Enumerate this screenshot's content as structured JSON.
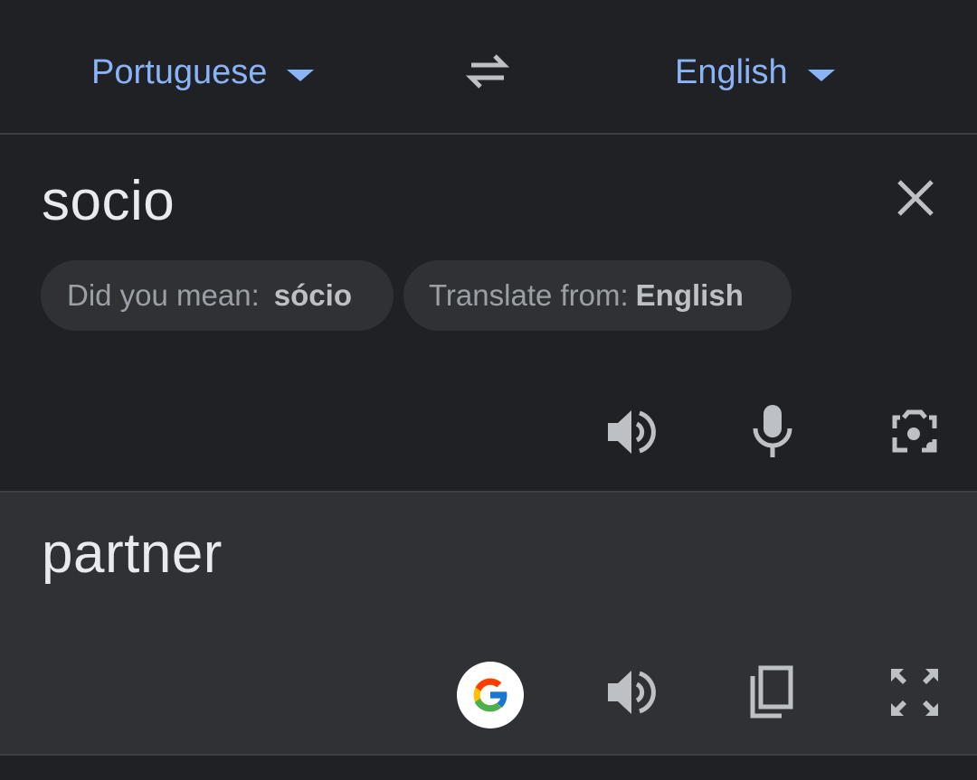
{
  "lang_bar": {
    "source_language": "Portuguese",
    "target_language": "English",
    "source_caret_icon": "caret-down-icon",
    "swap_icon": "swap-arrows-icon",
    "target_caret_icon": "caret-down-icon"
  },
  "input": {
    "text": "socio",
    "clear_icon": "close-icon",
    "suggestions": {
      "did_you_mean_label": "Did you mean:",
      "did_you_mean_value": "sócio",
      "translate_from_label": "Translate from:",
      "translate_from_value": "English"
    },
    "actions": {
      "listen_icon": "speaker-icon",
      "mic_icon": "microphone-icon",
      "camera_icon": "camera-lens-icon"
    }
  },
  "output": {
    "text": "partner",
    "actions": {
      "google_icon": "google-g-icon",
      "listen_icon": "speaker-icon",
      "copy_icon": "copy-icon",
      "fullscreen_icon": "fullscreen-icon"
    }
  },
  "colors": {
    "accent": "#8ab4f8",
    "background": "#202124",
    "output_background": "#303134",
    "chip_background": "#303134",
    "text_primary": "#e8eaed",
    "text_secondary": "#9aa0a6",
    "icon_color": "#bdc1c6"
  }
}
